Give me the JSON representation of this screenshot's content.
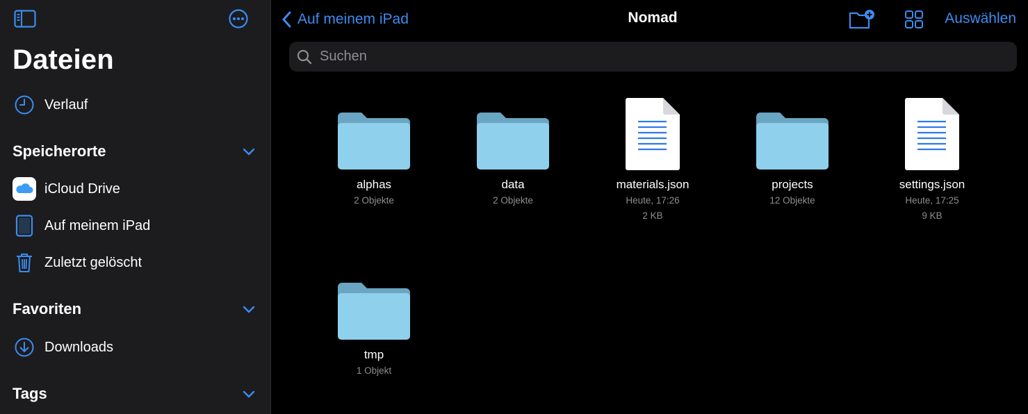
{
  "sidebar": {
    "title": "Dateien",
    "recents": {
      "label": "Verlauf"
    },
    "sections": {
      "locations": {
        "label": "Speicherorte"
      },
      "favorites": {
        "label": "Favoriten"
      },
      "tags": {
        "label": "Tags"
      }
    },
    "locations": [
      {
        "label": "iCloud Drive",
        "icon": "icloud-icon"
      },
      {
        "label": "Auf meinem iPad",
        "icon": "ipad-icon"
      },
      {
        "label": "Zuletzt gelöscht",
        "icon": "trash-icon"
      }
    ],
    "favorites": [
      {
        "label": "Downloads",
        "icon": "download-icon"
      }
    ]
  },
  "topbar": {
    "back_label": "Auf meinem iPad",
    "title": "Nomad",
    "select_label": "Auswählen"
  },
  "search": {
    "placeholder": "Suchen",
    "value": ""
  },
  "items": [
    {
      "name": "alphas",
      "type": "folder",
      "meta1": "2 Objekte"
    },
    {
      "name": "data",
      "type": "folder",
      "meta1": "2 Objekte"
    },
    {
      "name": "materials.json",
      "type": "file",
      "meta1": "Heute, 17:26",
      "meta2": "2 KB"
    },
    {
      "name": "projects",
      "type": "folder",
      "meta1": "12 Objekte"
    },
    {
      "name": "settings.json",
      "type": "file",
      "meta1": "Heute, 17:25",
      "meta2": "9 KB"
    },
    {
      "name": "tmp",
      "type": "folder",
      "meta1": "1 Objekt"
    }
  ],
  "colors": {
    "accent": "#3b8df0",
    "sidebar_bg": "#1c1c1e",
    "folder": "#8fd0ec"
  }
}
